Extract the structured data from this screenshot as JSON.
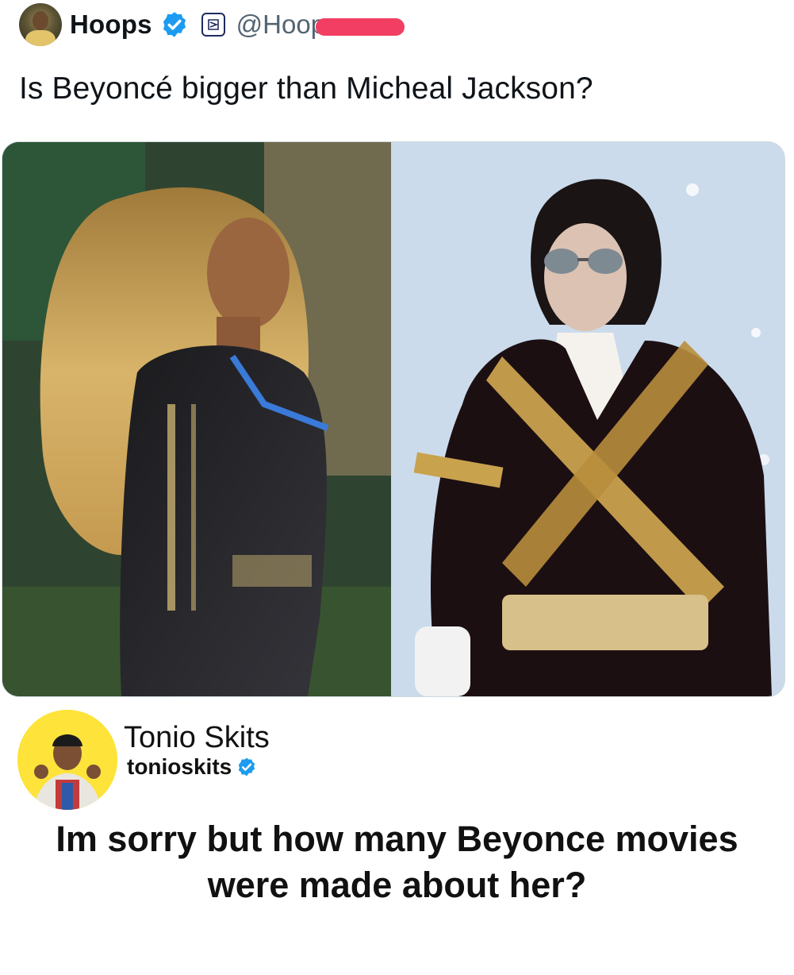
{
  "quoted_tweet": {
    "display_name": "Hoops",
    "handle": "@Hoop",
    "text": "Is Beyoncé bigger than Micheal Jackson?",
    "icons": {
      "verified": "verified-badge-icon",
      "affiliate": "affiliate-badge-icon"
    },
    "colors": {
      "verified_blue": "#1d9bf0",
      "redaction": "#f23e63"
    }
  },
  "media": {
    "images": [
      "beyonce-photo",
      "michael-jackson-photo"
    ]
  },
  "reply": {
    "display_name": "Tonio Skits",
    "handle": "tonioskits",
    "text_line1": "Im sorry but how many Beyonce movies",
    "text_line2": "were made about her?",
    "icons": {
      "verified": "verified-badge-icon"
    },
    "colors": {
      "avatar_bg": "#fde33a"
    }
  }
}
